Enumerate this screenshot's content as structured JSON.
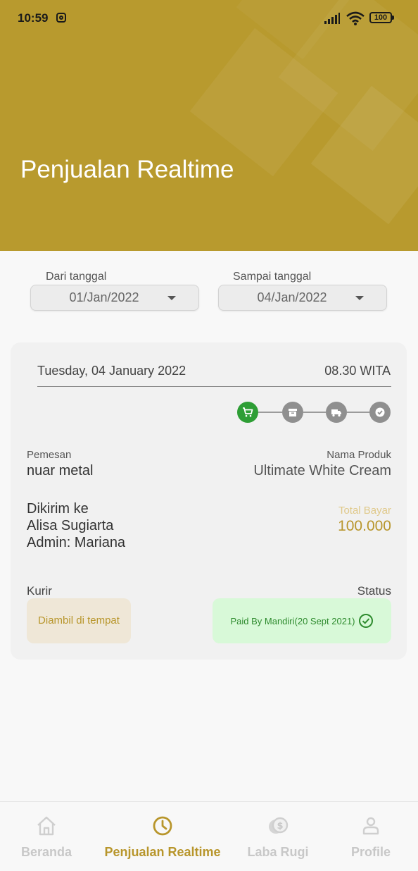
{
  "status_bar": {
    "time": "10:59",
    "battery": "100"
  },
  "header": {
    "title": "Penjualan Realtime"
  },
  "filters": {
    "from_label": "Dari tanggal",
    "from_value": "01/Jan/2022",
    "to_label": "Sampai tanggal",
    "to_value": "04/Jan/2022"
  },
  "order": {
    "date": "Tuesday, 04 January 2022",
    "time": "08.30 WITA",
    "progress_steps": [
      "cart-icon",
      "box-icon",
      "truck-icon",
      "check-icon"
    ],
    "current_step": 1,
    "customer_label": "Pemesan",
    "customer": "nuar metal",
    "product_label": "Nama Produk",
    "product": "Ultimate White Cream",
    "ship_label": "Dikirim ke",
    "ship_to": "Alisa Sugiarta",
    "admin": "Admin: Mariana",
    "total_label": "Total Bayar",
    "total_value": "100.000",
    "courier_label": "Kurir",
    "courier": "Diambil di tempat",
    "status_label": "Status",
    "status": "Paid By Mandiri(20 Sept 2021)"
  },
  "nav": {
    "items": [
      {
        "label": "Beranda",
        "icon": "home-icon"
      },
      {
        "label": "Penjualan Realtime",
        "icon": "clock-icon",
        "active": true
      },
      {
        "label": "Laba Rugi",
        "icon": "coins-icon"
      },
      {
        "label": "Profile",
        "icon": "person-icon"
      }
    ]
  },
  "colors": {
    "accent": "#b8962c",
    "header_bg": "#b89a2e",
    "step_active": "#2e9e35",
    "status_bg": "#d8f9d8"
  }
}
